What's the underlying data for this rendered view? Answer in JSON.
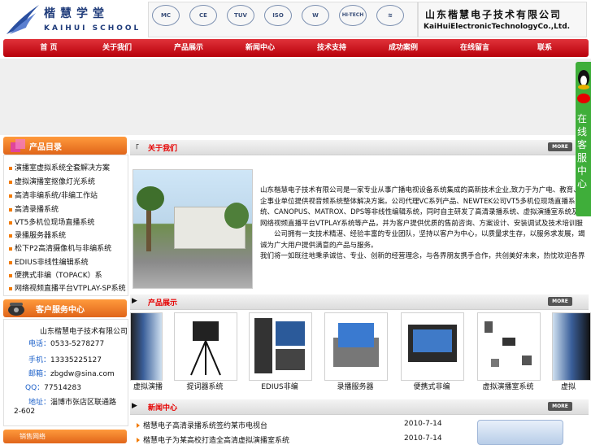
{
  "header": {
    "logo_cn": "楷慧学堂",
    "logo_en": "KAIHUI SCHOOL",
    "company_cn": "山东楷慧电子技术有限公司",
    "company_en": "KaiHuiElectronicTechnologyCo.,Ltd.",
    "certs": [
      "MC",
      "CE",
      "TUV",
      "ISO",
      "W",
      "HI-TECH",
      "≋"
    ]
  },
  "nav": [
    "首 页",
    "关于我们",
    "产品展示",
    "新闻中心",
    "技术支持",
    "成功案例",
    "在线留言",
    "联系"
  ],
  "left": {
    "catalog_title": "产品目录",
    "categories": [
      "演播室虚拟系统全套解决方案",
      "虚拟演播室抠像灯光系统",
      "高清非编系统/非编工作站",
      "高清录播系统",
      "VT5多机位现场直播系统",
      "录播服务器系统",
      "松下P2高清摄像机与非编系统",
      "EDIUS非线性编辑系统",
      "便携式非编（TOPACK）系",
      "网络视频直播平台VTPLAY-SP系统"
    ],
    "service_title": "客户服务中心",
    "service": {
      "company": "山东楷慧电子技术有限公司",
      "tel_label": "电话：",
      "tel": "0533-5278277",
      "mobile_label": "手机：",
      "mobile": "13335225127",
      "email_label": "邮箱：",
      "email": "zbgdw@sina.com",
      "qq_label": "QQ：",
      "qq": "77514283",
      "addr_label": "地址：",
      "addr_line1": "淄博市张店区联通路",
      "addr_line2": "2-602"
    },
    "sales_label": "销售网络"
  },
  "about": {
    "title": "关于我们",
    "more": "MORE",
    "mark": "「",
    "p1": "山东楷慧电子技术有限公司是一家专业从事广播电视设备系统集成的高新技术企业,致力于为广电、教育、企事业单位提供视音频系统整体解决方案。公司代理VC系列产品、NEWTEK公司VT5多机位现场直播系统、CANOPUS、MATROX、DPS等非线性编辑系统，同时自主研发了高清录播系统、虚拟演播室系统及网络视频直播平台VTPLAY系统等产品，并为客户提供优质的售前咨询、方案设计、安装调试及技术培训服务。",
    "p2": "公司拥有一支技术精湛、经验丰富的专业团队，坚持以客户为中心，以质量求生存，以服务求发展，竭诚为广大用户提供满意的产品与服务。",
    "p3": "我们将一如既往地秉承诚信、专业、创新的经营理念，与各界朋友携手合作，共创美好未来，热忱欢迎各界朋友光临指导、洽谈合作！"
  },
  "products": {
    "title": "产品展示",
    "more": "MORE",
    "names": [
      "虚拟演播",
      "提词器系统",
      "EDIUS非编",
      "录播服务器",
      "便携式非编",
      "虚拟演播室系统",
      "虚拟"
    ]
  },
  "news": {
    "title": "新闻中心",
    "more": "MORE",
    "items": [
      {
        "text": "楷慧电子高清录播系统签约某市电视台",
        "date": "2010-7-14"
      },
      {
        "text": "楷慧电子为某高校打造全高清虚拟演播室系统",
        "date": "2010-7-14"
      }
    ]
  },
  "online": {
    "label": "在线客服中心"
  }
}
